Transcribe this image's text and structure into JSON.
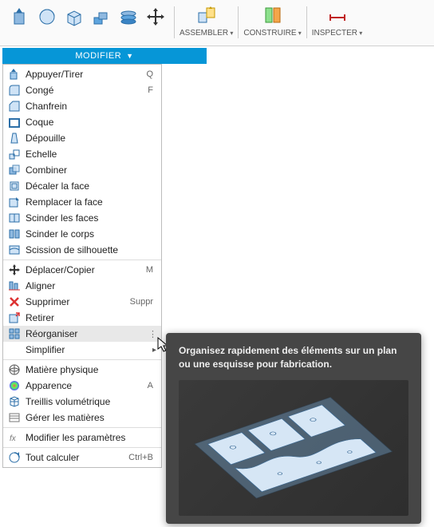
{
  "toolbar": {
    "groups": [
      {
        "label": "ASSEMBLER"
      },
      {
        "label": "CONSTRUIRE"
      },
      {
        "label": "INSPECTER"
      }
    ]
  },
  "dropdown": {
    "title": "MODIFIER"
  },
  "menu": {
    "items": [
      {
        "label": "Appuyer/Tirer",
        "shortcut": "Q"
      },
      {
        "label": "Congé",
        "shortcut": "F"
      },
      {
        "label": "Chanfrein"
      },
      {
        "label": "Coque"
      },
      {
        "label": "Dépouille"
      },
      {
        "label": "Echelle"
      },
      {
        "label": "Combiner"
      },
      {
        "label": "Décaler la face"
      },
      {
        "label": "Remplacer la face"
      },
      {
        "label": "Scinder les faces"
      },
      {
        "label": "Scinder le corps"
      },
      {
        "label": "Scission de silhouette"
      },
      {
        "sep": true
      },
      {
        "label": "Déplacer/Copier",
        "shortcut": "M"
      },
      {
        "label": "Aligner"
      },
      {
        "label": "Supprimer",
        "shortcut": "Suppr"
      },
      {
        "label": "Retirer"
      },
      {
        "label": "Réorganiser",
        "highlight": true,
        "more": true
      },
      {
        "label": "Simplifier",
        "indent": true,
        "submenu": true
      },
      {
        "sep": true
      },
      {
        "label": "Matière physique"
      },
      {
        "label": "Apparence",
        "shortcut": "A"
      },
      {
        "label": "Treillis volumétrique"
      },
      {
        "label": "Gérer les matières"
      },
      {
        "sep": true
      },
      {
        "label": "Modifier les paramètres"
      },
      {
        "sep": true
      },
      {
        "label": "Tout calculer",
        "shortcut": "Ctrl+B"
      }
    ]
  },
  "tooltip": {
    "text": "Organisez rapidement des éléments sur un plan ou une esquisse pour fabrication."
  }
}
